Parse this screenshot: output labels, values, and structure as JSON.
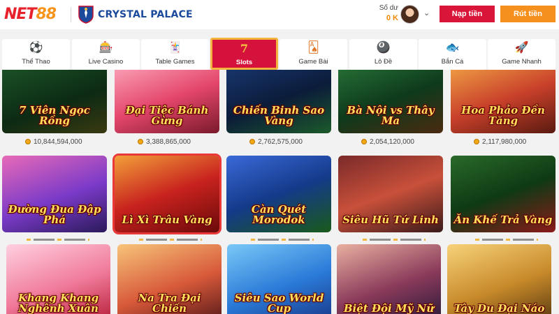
{
  "header": {
    "logo_main": "NET",
    "logo_accent": "88",
    "partner_name": "CRYSTAL PALACE",
    "balance_label": "Số dư",
    "balance_value": "0 K",
    "deposit_label": "Nạp tiền",
    "withdraw_label": "Rút tiền"
  },
  "tabs": [
    {
      "label": "Thể Thao",
      "icon": "soccer-ball-icon",
      "glyph": "⚽",
      "active": false
    },
    {
      "label": "Live Casino",
      "icon": "poker-chip-icon",
      "glyph": "🎰",
      "active": false
    },
    {
      "label": "Table Games",
      "icon": "cards-icon",
      "glyph": "🃏",
      "active": false
    },
    {
      "label": "Slots",
      "icon": "lucky-seven-icon",
      "glyph": "7",
      "active": true
    },
    {
      "label": "Game Bài",
      "icon": "card-hand-icon",
      "glyph": "🂡",
      "active": false
    },
    {
      "label": "Lô Đề",
      "icon": "lottery-ball-icon",
      "glyph": "🎱",
      "active": false
    },
    {
      "label": "Bắn Cá",
      "icon": "fish-icon",
      "glyph": "🐟",
      "active": false
    },
    {
      "label": "Game Nhanh",
      "icon": "rocket-icon",
      "glyph": "🚀",
      "active": false
    }
  ],
  "games": [
    {
      "title": "7 Viên Ngọc Rồng",
      "jackpot": "10,844,594,000",
      "bg": "linear-gradient(160deg,#1e5a2a,#0c2a14 60%,#3a3a10)"
    },
    {
      "title": "Đại Tiệc Bánh Gừng",
      "jackpot": "3,388,865,000",
      "bg": "linear-gradient(160deg,#ffb3c6,#e4466b 55%,#7a1a2a)"
    },
    {
      "title": "Chiến Binh Sao Vàng",
      "jackpot": "2,762,575,000",
      "bg": "linear-gradient(160deg,#1b3b7a,#0b1c3a 55%,#1c5a2a)"
    },
    {
      "title": "Bà Nội vs Thây Ma",
      "jackpot": "2,054,120,000",
      "bg": "linear-gradient(160deg,#2a7a3a,#0e3a1c 55%,#4a2a10)"
    },
    {
      "title": "Hoa Phảo Đền Tăng",
      "jackpot": "2,117,980,000",
      "bg": "linear-gradient(160deg,#f7b04a,#c8402a 55%,#5a1a10)"
    },
    {
      "title": "Đường Đua Đập Phá",
      "jackpot": "",
      "bg": "linear-gradient(160deg,#e86ab8,#7a3ac8 55%,#2a1a5a)"
    },
    {
      "title": "Lì Xì Trâu Vàng",
      "jackpot": "",
      "bg": "linear-gradient(160deg,#f2a03a,#c8221e 50%,#6a0a0a)"
    },
    {
      "title": "Càn Quét Morodok",
      "jackpot": "",
      "bg": "linear-gradient(160deg,#3a6ad8,#143a8a 50%,#1a5a1a)"
    },
    {
      "title": "Siêu Hũ Tứ Linh",
      "jackpot": "",
      "bg": "linear-gradient(160deg,#7a2a2a,#c8503a 50%,#3a1a1a)"
    },
    {
      "title": "Ăn Khế Trả Vàng",
      "jackpot": "",
      "bg": "linear-gradient(160deg,#2a6a2a,#0e3a14 50%,#8a1a1a)"
    },
    {
      "title": "Khang Khang Nghênh Xuân",
      "jackpot": "",
      "bg": "linear-gradient(160deg,#ffd0e0,#f07a9a 55%,#b8203a)"
    },
    {
      "title": "Na Tra Đại Chiến",
      "jackpot": "",
      "bg": "linear-gradient(160deg,#f7c47a,#d85a3a 55%,#5a1a1a)"
    },
    {
      "title": "Siêu Sao World Cup",
      "jackpot": "",
      "bg": "linear-gradient(160deg,#7ac8f7,#2a7ad8 55%,#1a3a8a)"
    },
    {
      "title": "Biệt Đội Mỹ Nữ",
      "jackpot": "",
      "bg": "linear-gradient(160deg,#e8b0a0,#8a3a5a 55%,#2a1a3a)"
    },
    {
      "title": "Tây Du Đại Náo",
      "jackpot": "",
      "bg": "linear-gradient(160deg,#f7d27a,#c88a2a 55%,#5a3a10)"
    }
  ],
  "colors": {
    "brand_red": "#e8222d",
    "active_tab": "#d4123c",
    "active_tab_border": "#f3b43e",
    "deposit_button": "#d9163a",
    "withdraw_button": "#f5901e",
    "coin": "#f0a816"
  }
}
